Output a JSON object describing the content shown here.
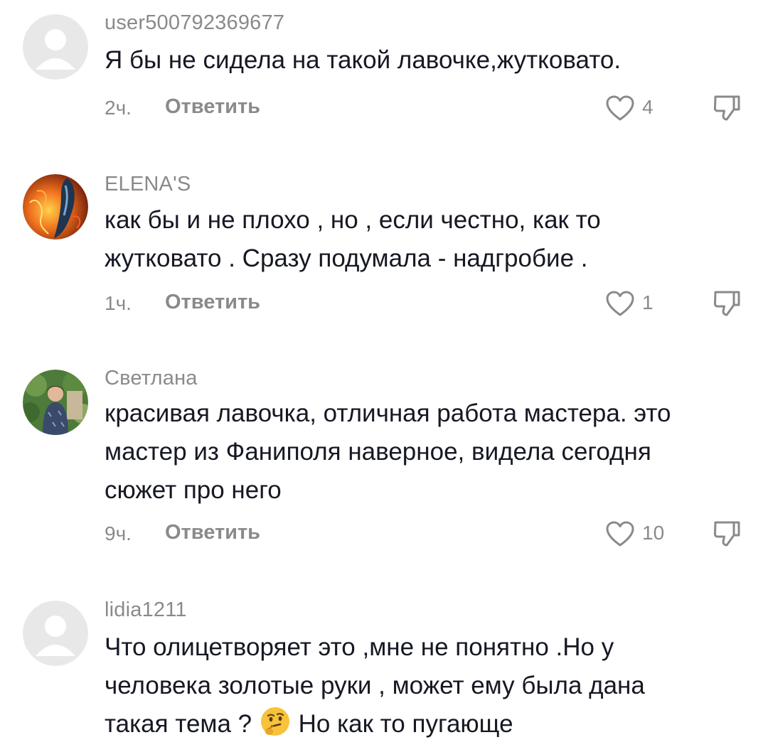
{
  "comments": [
    {
      "username": "user500792369677",
      "lines": [
        "Я бы не сидела на такой лавочке,жутковато."
      ],
      "time": "2ч.",
      "reply_label": "Ответить",
      "likes": "4"
    },
    {
      "username": "ELENA'S",
      "lines": [
        "как бы и не плохо , но , если честно, как то",
        "жутковато . Сразу подумала - надгробие ."
      ],
      "time": "1ч.",
      "reply_label": "Ответить",
      "likes": "1"
    },
    {
      "username": "Светлана",
      "lines": [
        "красивая лавочка, отличная работа мастера. это",
        "мастер из Фаниполя наверное, видела сегодня",
        "сюжет про него"
      ],
      "time": "9ч.",
      "reply_label": "Ответить",
      "likes": "10"
    },
    {
      "username": "lidia1211",
      "lines": [
        "Что олицетворяет это ,мне не понятно .Но у",
        "человека золотые руки , может ему была дана",
        "такая тема ?",
        "Но как то пугающе"
      ],
      "emoji": "thinking-face",
      "time": "",
      "reply_label": "",
      "likes": ""
    }
  ],
  "icons": {
    "like": "heart-outline-icon",
    "dislike": "thumbs-down-outline-icon"
  },
  "colors": {
    "text": "#161823",
    "secondary": "#8a8a8a",
    "default_avatar_bg": "#e6e6e6"
  }
}
